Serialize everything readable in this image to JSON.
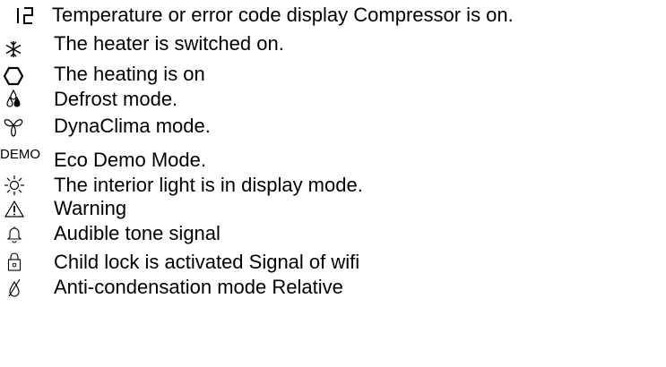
{
  "legend": [
    {
      "icon": "seven-segment-digits-icon",
      "text": "Temperature or error code display Compressor is on."
    },
    {
      "icon": "snowflake-icon",
      "text": "The heater is switched on."
    },
    {
      "icon": "heating-sun-icon",
      "text": "The heating is on"
    },
    {
      "icon": "droplets-icon",
      "text": "Defrost mode."
    },
    {
      "icon": "fan-icon",
      "text": "DynaClima mode."
    },
    {
      "icon": "demo-icon",
      "icon_label": "DEMO",
      "text": "Eco Demo Mode."
    },
    {
      "icon": "interior-light-icon",
      "text": "The interior light is in display mode."
    },
    {
      "icon": "warning-icon",
      "text": "Warning"
    },
    {
      "icon": "bell-icon",
      "text": "Audible tone signal"
    },
    {
      "icon": "padlock-icon",
      "text": "Child lock is activated Signal of wifi"
    },
    {
      "icon": "anti-condensation-icon",
      "text": "Anti-condensation mode Relative"
    }
  ]
}
